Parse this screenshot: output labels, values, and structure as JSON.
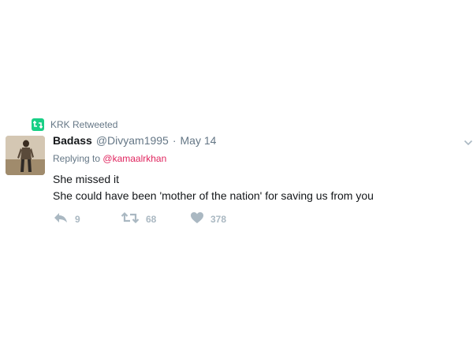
{
  "retweet_context": {
    "text": "KRK Retweeted",
    "icon": "retweet-icon",
    "color": "#19cf86"
  },
  "tweet": {
    "display_name": "Badass",
    "handle": "@Divyam1995",
    "separator": "·",
    "date": "May 14",
    "reply_prefix": "Replying to",
    "reply_to": "@kamaalrkhan",
    "text_lines": [
      "She missed it",
      "She could have been 'mother of the nation' for saving us from you"
    ],
    "avatar_icon": "avatar-photo"
  },
  "actions": {
    "reply": {
      "icon": "reply-icon",
      "count": "9"
    },
    "retweet": {
      "icon": "retweet-icon",
      "count": "68"
    },
    "like": {
      "icon": "heart-icon",
      "count": "378"
    }
  },
  "menu": {
    "icon": "chevron-down-icon"
  },
  "colors": {
    "text": "#14171a",
    "secondary": "#657786",
    "mention": "#e0245e",
    "action_gray": "#aab8c2"
  }
}
